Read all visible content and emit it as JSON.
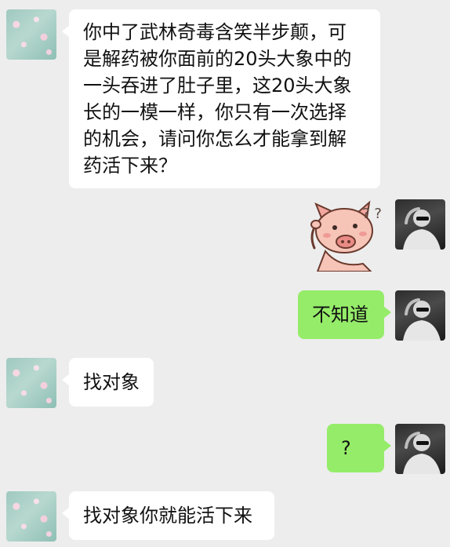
{
  "messages": [
    {
      "side": "left",
      "type": "text",
      "text": "你中了武林奇毒含笑半步颠，可是解药被你面前的20头大象中的一头吞进了肚子里，这20头大象长的一模一样，你只有一次选择的机会，请问你怎么才能拿到解药活下来？",
      "lines": [
        "你中了武林奇毒含笑半步颠，可",
        "是解药被你面前的20头大象中的",
        "一头吞进了肚子里，这20头大象",
        "长的一模一样，你只有一次选择",
        "的机会，请问你怎么才能拿到解",
        "药活下来？"
      ]
    },
    {
      "side": "right",
      "type": "sticker",
      "sticker": "confused-pig-sticker",
      "text": "? ?"
    },
    {
      "side": "right",
      "type": "text",
      "text": "不知道"
    },
    {
      "side": "left",
      "type": "text",
      "text": "找对象"
    },
    {
      "side": "right",
      "type": "text",
      "text": "?"
    },
    {
      "side": "left",
      "type": "text",
      "text": "找对象你就能活下来"
    }
  ],
  "colors": {
    "background": "#ededed",
    "incoming_bubble": "#ffffff",
    "outgoing_bubble": "#95ec69",
    "text": "#111111"
  }
}
